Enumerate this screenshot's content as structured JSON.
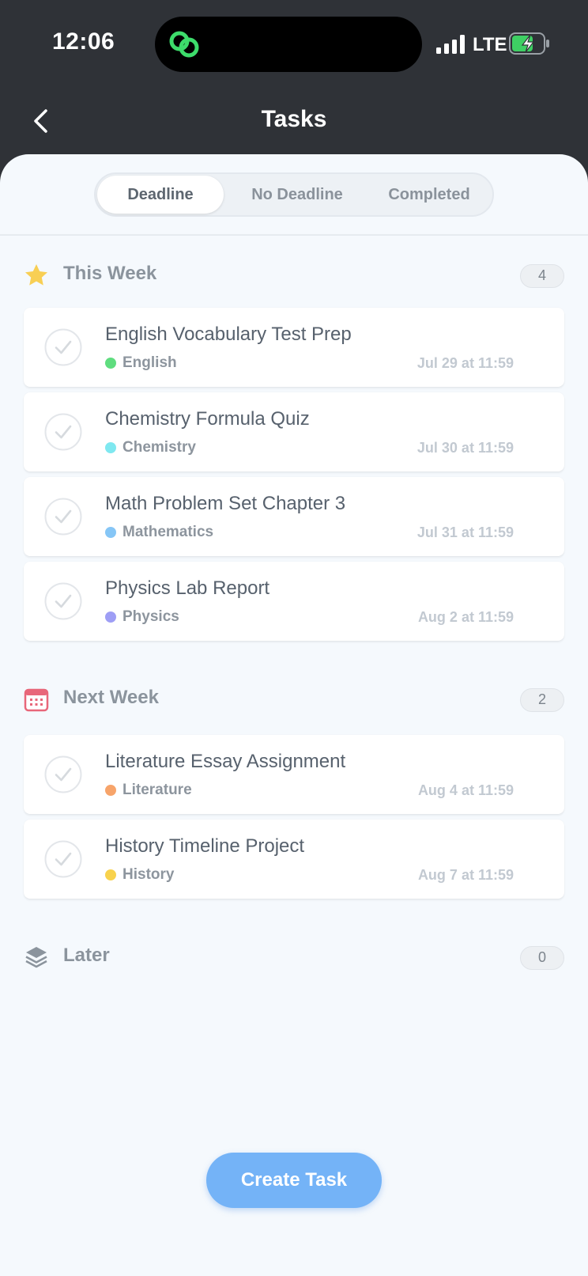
{
  "status_bar": {
    "time": "12:06",
    "network": "LTE"
  },
  "nav": {
    "title": "Tasks"
  },
  "tabs": [
    {
      "label": "Deadline",
      "active": true
    },
    {
      "label": "No Deadline",
      "active": false
    },
    {
      "label": "Completed",
      "active": false
    }
  ],
  "sections": [
    {
      "title": "This Week",
      "icon": "star-icon",
      "count": "4",
      "tasks": [
        {
          "title": "English Vocabulary Test Prep",
          "subject": "English",
          "color": "#5fdd7f",
          "due": "Jul 29 at 11:59"
        },
        {
          "title": "Chemistry Formula Quiz",
          "subject": "Chemistry",
          "color": "#7fe8f0",
          "due": "Jul 30 at 11:59"
        },
        {
          "title": "Math Problem Set Chapter 3",
          "subject": "Mathematics",
          "color": "#86c6f6",
          "due": "Jul 31 at 11:59"
        },
        {
          "title": "Physics Lab Report",
          "subject": "Physics",
          "color": "#9e9ef5",
          "due": "Aug 2 at 11:59"
        }
      ]
    },
    {
      "title": "Next Week",
      "icon": "calendar-icon",
      "count": "2",
      "tasks": [
        {
          "title": "Literature Essay Assignment",
          "subject": "Literature",
          "color": "#f7a46a",
          "due": "Aug 4 at 11:59"
        },
        {
          "title": "History Timeline Project",
          "subject": "History",
          "color": "#f8d24d",
          "due": "Aug 7 at 11:59"
        }
      ]
    },
    {
      "title": "Later",
      "icon": "layers-icon",
      "count": "0",
      "tasks": []
    }
  ],
  "create_button": {
    "label": "Create Task"
  },
  "colors": {
    "header_bg": "#2f3237",
    "sheet_bg": "#f5f9fd",
    "accent": "#74b3f7",
    "star": "#f8cf54",
    "calendar": "#e8677a"
  }
}
